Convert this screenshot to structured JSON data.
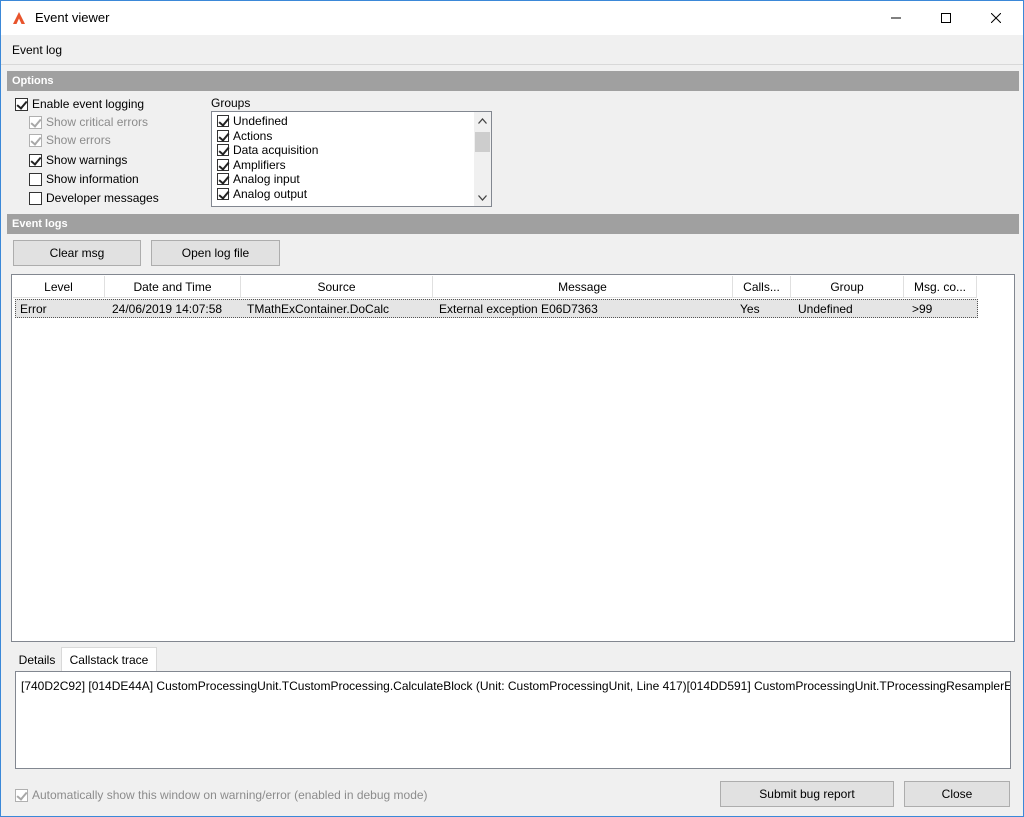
{
  "window": {
    "title": "Event viewer",
    "minimize_glyph": "─",
    "maximize_glyph": "☐",
    "close_glyph": "✕"
  },
  "menu": {
    "items": [
      "Event log"
    ]
  },
  "options": {
    "header": "Options",
    "enable_event_logging": {
      "label": "Enable event logging",
      "checked": true
    },
    "show_critical_errors": {
      "label": "Show critical errors",
      "checked": true,
      "disabled": true
    },
    "show_errors": {
      "label": "Show errors",
      "checked": true,
      "disabled": true
    },
    "show_warnings": {
      "label": "Show warnings",
      "checked": true
    },
    "show_information": {
      "label": "Show information",
      "checked": false
    },
    "developer_messages": {
      "label": "Developer messages",
      "checked": false
    },
    "groups_label": "Groups",
    "groups": [
      {
        "label": "Undefined",
        "checked": true
      },
      {
        "label": "Actions",
        "checked": true
      },
      {
        "label": "Data acquisition",
        "checked": true
      },
      {
        "label": "Amplifiers",
        "checked": true
      },
      {
        "label": "Analog input",
        "checked": true
      },
      {
        "label": "Analog output",
        "checked": true
      }
    ]
  },
  "event_logs": {
    "header": "Event logs",
    "clear_button": "Clear msg",
    "open_button": "Open log file",
    "columns": [
      "Level",
      "Date and Time",
      "Source",
      "Message",
      "Calls...",
      "Group",
      "Msg. co..."
    ],
    "rows": [
      {
        "level": "Error",
        "datetime": "24/06/2019 14:07:58",
        "source": "TMathExContainer.DoCalc",
        "message": "External exception E06D7363",
        "calls": "Yes",
        "group": "Undefined",
        "count": ">99"
      }
    ]
  },
  "detail_tabs": {
    "details": "Details",
    "callstack": "Callstack trace",
    "active": "Callstack trace",
    "trace_text": "[740D2C92] [014DE44A] CustomProcessingUnit.TCustomProcessing.CalculateBlock (Unit: CustomProcessingUnit, Line 417)[014DD591] CustomProcessingUnit.TProcessingResamplerEng"
  },
  "footer": {
    "auto_show": {
      "label": "Automatically show this window on warning/error (enabled in debug mode)",
      "checked": true,
      "disabled": true
    },
    "submit_button": "Submit bug report",
    "close_button": "Close"
  },
  "colors": {
    "section_header": "#a0a0a0",
    "window_border": "#3b88d8",
    "app_icon": "#e8542c"
  }
}
